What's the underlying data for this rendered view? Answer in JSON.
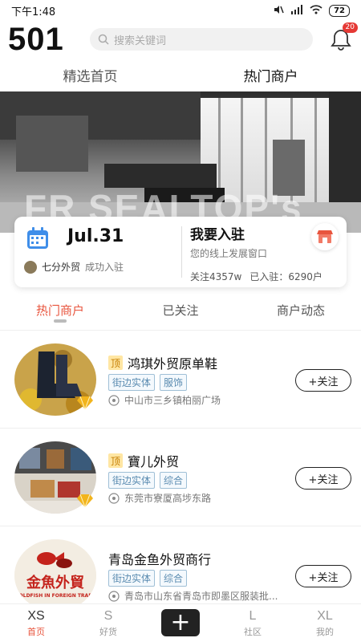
{
  "status_bar": {
    "time": "下午1:48",
    "battery": "72"
  },
  "header": {
    "logo": "501",
    "search_placeholder": "搜索关键词",
    "notification_count": "20"
  },
  "top_tabs": [
    {
      "label": "精选首页",
      "active": false
    },
    {
      "label": "热门商户",
      "active": true
    }
  ],
  "banner": {
    "overlay_text": "FR SEALTOP's"
  },
  "info_card": {
    "date": "Jul.31",
    "news_name": "七分外贸",
    "news_text": "成功入驻",
    "join_title": "我要入驻",
    "join_subtitle": "您的线上发展窗口",
    "followers": "关注4357w",
    "joined": "已入驻：6290户"
  },
  "sub_tabs": [
    {
      "label": "热门商户",
      "active": true
    },
    {
      "label": "已关注",
      "active": false
    },
    {
      "label": "商户动态",
      "active": false
    }
  ],
  "merchants": [
    {
      "top_tag": "顶",
      "name": "鸿琪外贸原单鞋",
      "tags": [
        "街边实体",
        "服饰"
      ],
      "address": "中山市三乡镇柏丽广场",
      "follow_label": "+关注"
    },
    {
      "top_tag": "顶",
      "name": "寶儿外贸",
      "tags": [
        "街边实体",
        "综合"
      ],
      "address": "东莞市寮厦高埗东路",
      "follow_label": "+关注"
    },
    {
      "top_tag": "",
      "name": "青岛金鱼外贸商行",
      "tags": [
        "街边实体",
        "综合"
      ],
      "address": "青岛市山东省青岛市即墨区服装批...",
      "follow_label": "+关注",
      "logo_text": "金魚外貿",
      "logo_subtext": "GOLDFISH IN FOREIGN TRADE"
    }
  ],
  "bottom_nav": [
    {
      "glyph": "XS",
      "label": "首页",
      "active": true
    },
    {
      "glyph": "S",
      "label": "好货",
      "active": false
    },
    {
      "glyph": "+",
      "label": "",
      "active": false
    },
    {
      "glyph": "L",
      "label": "社区",
      "active": false
    },
    {
      "glyph": "XL",
      "label": "我的",
      "active": false
    }
  ],
  "colors": {
    "accent": "#e8553e",
    "tag_border": "#9fbfd6",
    "tag_text": "#5a8bb0",
    "badge": "#e53935"
  }
}
